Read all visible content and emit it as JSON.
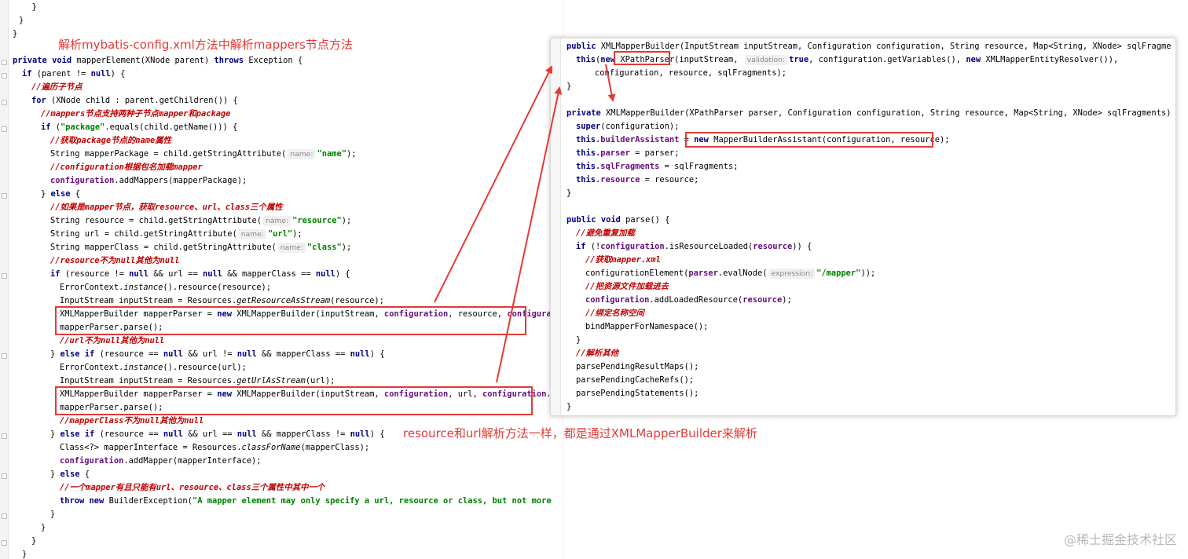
{
  "annotations": {
    "top_note": "解析mybatis-config.xml方法中解析mappers节点方法",
    "bottom_note": "resource和url解析方法一样，都是通过XMLMapperBuilder来解析",
    "watermark": "@稀土掘金技术社区",
    "accent_color": "#e53935"
  },
  "left": {
    "l0": "  }",
    "l1": "}",
    "l2": "private",
    "l2b": "void",
    "l2c": " mapperElement(XNode parent) ",
    "l2d": "throws",
    "l2e": " Exception {",
    "l3": "if",
    "l3b": " (parent != ",
    "l3c": "null",
    "l3d": ") {",
    "c_traverse": "//遍历子节点",
    "l5": "for",
    "l5b": " (XNode child : parent.getChildren()) {",
    "c_mappers": "//mappers节点支持两种子节点mapper和package",
    "l7": "if",
    "l7b": " (",
    "l7c": "\"package\"",
    "l7d": ".equals(child.getName())) {",
    "c_pkg": "//获取package节点的name属性",
    "l9": "String mapperPackage = child.getStringAttribute(",
    "hint_name": "name:",
    "s_name": "\"name\"",
    "end": ");",
    "c_cfg": "//configuration根据包名加载mapper",
    "configuration": "configuration",
    "l11": ".addMappers(mapperPackage);",
    "l12": "} ",
    "else": "else",
    "brace": " {",
    "c_mapper": "//如果是mapper节点，获取resource、url、class三个属性",
    "l14": "String resource = child.getStringAttribute(",
    "s_resource": "\"resource\"",
    "l15": "String url = child.getStringAttribute(",
    "s_url": "\"url\"",
    "l16": "String mapperClass = child.getStringAttribute(",
    "s_class": "\"class\"",
    "c_res": "//resource不为null其他为null",
    "l18": "if",
    "l18b": " (resource != ",
    "null": "null",
    "and_url": " && url == ",
    "and_mc": " && mapperClass == ",
    "close": ") {",
    "l19": "ErrorContext.",
    "instance": "instance",
    "l19b": "().resource(resource);",
    "l20": "InputStream inputStream = Resources.",
    "getRes": "getResourceAsStream",
    "l20b": "(resource);",
    "l21": "XMLMapperBuilder mapperParser = ",
    "new": "new",
    "l21b": " XMLMapperBuilder(inputStream, ",
    "l21c": ", resource, ",
    "l22": "mapperParser.parse();",
    "c_url": "//url不为null其他为null",
    "l24a": "} ",
    "elseif": "else if",
    "l24b": " (resource == ",
    "l24c": " && url != ",
    "l25b": "().resource(url);",
    "getUrl": "getUrlAsStream",
    "l26b": "(url);",
    "l27c": ", url, ",
    "l27d": ".getSq",
    "c_mc": "//mapperClass不为null其他为null",
    "l30c": " && url == ",
    "l30d": " && mapperClass != ",
    "l31": "Class<?> mapperInterface = Resources.",
    "classForName": "classForName",
    "l31b": "(mapperClass);",
    "l32": ".addMapper(mapperInterface);",
    "l33": "} ",
    "c_one": "//一个mapper有且只能有url、resource、class三个属性中其中一个",
    "throw": "throw",
    "l35b": " BuilderException(",
    "s_err": "\"A mapper element may only specify a url, resource or class, but not more than one.\"",
    "rb": "}",
    "rb2": "}",
    "rb3": "}"
  },
  "right": {
    "r1a": "public",
    "r1b": " XMLMapperBuilder(InputStream inputStream, Configuration configuration, String resource, Map<String, XNode> sqlFragments) {",
    "this": "this",
    "r2b": "(",
    "new": "new",
    "r2c": " XPathParser",
    "r2d": "(inputStream, ",
    "hint_validation": "validation:",
    "true": "true",
    "r2e": ", configuration.getVariables(), ",
    "r2f": " XMLMapperEntityResolver()),",
    "r3": "configuration, resource, sqlFragments);",
    "rb": "}",
    "r5a": "private",
    "r5b": " XMLMapperBuilder(XPathParser parser, Configuration configuration, String resource, Map<String, XNode> sqlFragments) {",
    "super": "super",
    "r6b": "(configuration);",
    "r7b": ".builderAssistant",
    "eq": " = ",
    "r7d": " MapperBuilderAssistant(configuration, resource);",
    "r8b": ".parser",
    "r8c": " = parser;",
    "r9b": ".sqlFragments",
    "r9c": " = sqlFragments;",
    "r10b": ".resource",
    "r10c": " = resource;",
    "r12a": "public",
    "void": "void",
    "r12c": " parse() {",
    "c_repeat": "//避免重复加载",
    "if": "if",
    "r14b": " (!",
    "configuration": "configuration",
    "r14c": ".isResourceLoaded(",
    "resource": "resource",
    "r14d": ")) {",
    "c_get": "//获取mapper.xml",
    "r16a": "configurationElement(",
    "parser": "parser",
    "r16b": ".evalNode(",
    "hint_expression": "expression:",
    "s_mapper": "\"/mapper\"",
    "r16c": "));",
    "c_load": "//把资源文件加载进去",
    "r18b": ".addLoadedResource(",
    "r18c": ");",
    "c_bind": "//绑定名称空间",
    "r20": "bindMapperForNamespace();",
    "c_other": "//解析其他",
    "r23": "parsePendingResultMaps();",
    "r24": "parsePendingCacheRefs();",
    "r25": "parsePendingStatements();"
  }
}
